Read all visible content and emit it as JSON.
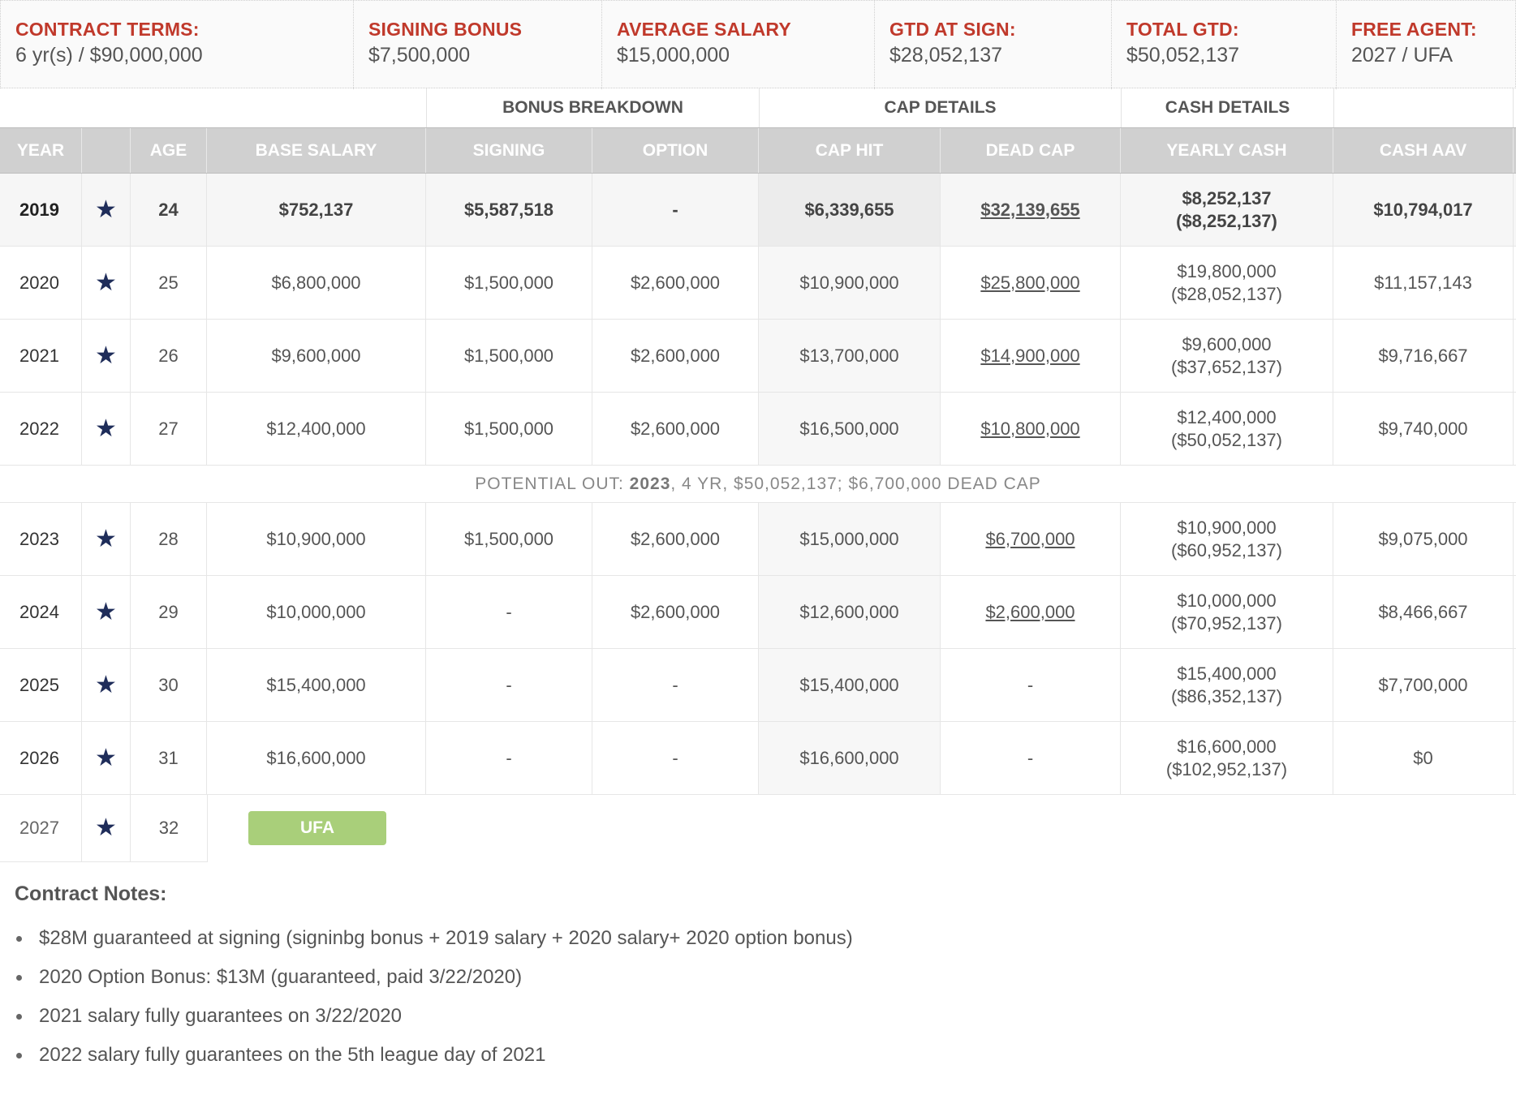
{
  "summary": {
    "contract_terms": {
      "label": "CONTRACT TERMS:",
      "value": "6 yr(s) / $90,000,000"
    },
    "signing_bonus": {
      "label": "SIGNING BONUS",
      "value": "$7,500,000"
    },
    "average_salary": {
      "label": "AVERAGE SALARY",
      "value": "$15,000,000"
    },
    "gtd_at_sign": {
      "label": "GTD AT SIGN:",
      "value": "$28,052,137"
    },
    "total_gtd": {
      "label": "TOTAL GTD:",
      "value": "$50,052,137"
    },
    "free_agent": {
      "label": "FREE AGENT:",
      "value": "2027 / UFA"
    }
  },
  "groups": {
    "bonus": "BONUS BREAKDOWN",
    "cap": "CAP DETAILS",
    "cash": "CASH DETAILS"
  },
  "columns": {
    "year": "YEAR",
    "age": "AGE",
    "base_salary": "BASE SALARY",
    "signing": "SIGNING",
    "option": "OPTION",
    "cap_hit": "CAP HIT",
    "dead_cap": "DEAD CAP",
    "yearly_cash": "YEARLY CASH",
    "cash_aav": "CASH AAV"
  },
  "team_icon": "star-icon",
  "rows": [
    {
      "year": "2019",
      "age": "24",
      "base": "$752,137",
      "signing": "$5,587,518",
      "option": "-",
      "cap_hit": "$6,339,655",
      "dead_cap": "$32,139,655",
      "cash": "$8,252,137",
      "cash_cum": "($8,252,137)",
      "aav": "$10,794,017"
    },
    {
      "year": "2020",
      "age": "25",
      "base": "$6,800,000",
      "signing": "$1,500,000",
      "option": "$2,600,000",
      "cap_hit": "$10,900,000",
      "dead_cap": "$25,800,000",
      "cash": "$19,800,000",
      "cash_cum": "($28,052,137)",
      "aav": "$11,157,143"
    },
    {
      "year": "2021",
      "age": "26",
      "base": "$9,600,000",
      "signing": "$1,500,000",
      "option": "$2,600,000",
      "cap_hit": "$13,700,000",
      "dead_cap": "$14,900,000",
      "cash": "$9,600,000",
      "cash_cum": "($37,652,137)",
      "aav": "$9,716,667"
    },
    {
      "year": "2022",
      "age": "27",
      "base": "$12,400,000",
      "signing": "$1,500,000",
      "option": "$2,600,000",
      "cap_hit": "$16,500,000",
      "dead_cap": "$10,800,000",
      "cash": "$12,400,000",
      "cash_cum": "($50,052,137)",
      "aav": "$9,740,000"
    },
    {
      "year": "2023",
      "age": "28",
      "base": "$10,900,000",
      "signing": "$1,500,000",
      "option": "$2,600,000",
      "cap_hit": "$15,000,000",
      "dead_cap": "$6,700,000",
      "cash": "$10,900,000",
      "cash_cum": "($60,952,137)",
      "aav": "$9,075,000"
    },
    {
      "year": "2024",
      "age": "29",
      "base": "$10,000,000",
      "signing": "-",
      "option": "$2,600,000",
      "cap_hit": "$12,600,000",
      "dead_cap": "$2,600,000",
      "cash": "$10,000,000",
      "cash_cum": "($70,952,137)",
      "aav": "$8,466,667"
    },
    {
      "year": "2025",
      "age": "30",
      "base": "$15,400,000",
      "signing": "-",
      "option": "-",
      "cap_hit": "$15,400,000",
      "dead_cap": "-",
      "cash": "$15,400,000",
      "cash_cum": "($86,352,137)",
      "aav": "$7,700,000"
    },
    {
      "year": "2026",
      "age": "31",
      "base": "$16,600,000",
      "signing": "-",
      "option": "-",
      "cap_hit": "$16,600,000",
      "dead_cap": "-",
      "cash": "$16,600,000",
      "cash_cum": "($102,952,137)",
      "aav": "$0"
    }
  ],
  "potential_out": {
    "prefix": "POTENTIAL OUT: ",
    "year": "2023",
    "suffix": ", 4 YR, $50,052,137; $6,700,000 DEAD CAP"
  },
  "final_row": {
    "year": "2027",
    "age": "32",
    "badge": "UFA"
  },
  "notes": {
    "title": "Contract Notes:",
    "items": [
      "$28M guaranteed at signing (signinbg bonus + 2019 salary + 2020 salary+ 2020 option bonus)",
      "2020 Option Bonus: $13M (guaranteed, paid 3/22/2020)",
      "2021 salary fully guarantees on 3/22/2020",
      "2022 salary fully guarantees on the 5th league day of 2021"
    ]
  },
  "colors": {
    "label_red": "#c0392b",
    "header_gray": "#d0d0d0",
    "ufa_green": "#a9cf7a",
    "star_navy": "#1f2d5a"
  }
}
